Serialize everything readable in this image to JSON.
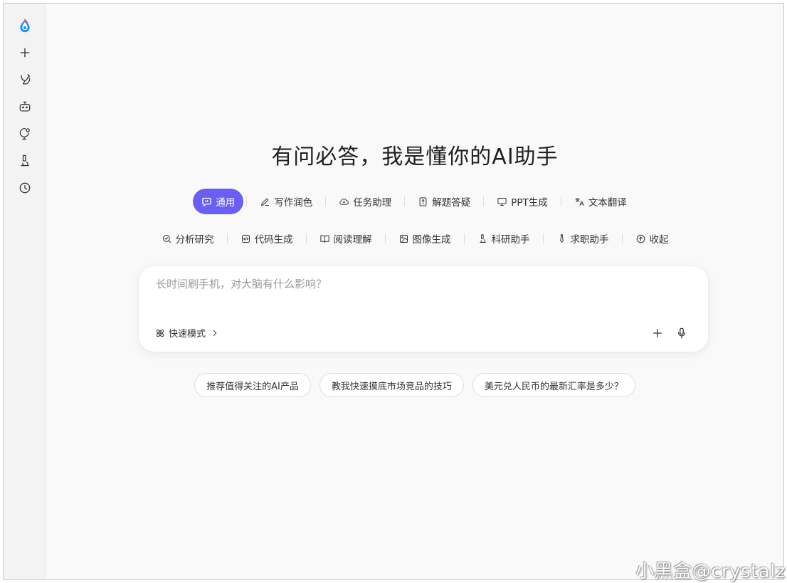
{
  "headline": "有问必答，我是懂你的AI助手",
  "tabs_row1": [
    {
      "label": "通用",
      "icon": "chat-bubble-icon",
      "active": true
    },
    {
      "label": "写作润色",
      "icon": "pen-icon"
    },
    {
      "label": "任务助理",
      "icon": "cloud-task-icon"
    },
    {
      "label": "解题答疑",
      "icon": "question-doc-icon"
    },
    {
      "label": "PPT生成",
      "icon": "presentation-icon"
    },
    {
      "label": "文本翻译",
      "icon": "translate-icon"
    }
  ],
  "tabs_row2": [
    {
      "label": "分析研究",
      "icon": "magnify-check-icon"
    },
    {
      "label": "代码生成",
      "icon": "code-icon"
    },
    {
      "label": "阅读理解",
      "icon": "book-icon"
    },
    {
      "label": "图像生成",
      "icon": "image-icon"
    },
    {
      "label": "科研助手",
      "icon": "microscope-icon"
    },
    {
      "label": "求职助手",
      "icon": "tie-icon"
    },
    {
      "label": "收起",
      "icon": "collapse-up-icon"
    }
  ],
  "input": {
    "placeholder": "长时间刷手机，对大脑有什么影响？",
    "mode_label": "快速模式"
  },
  "suggestions": [
    "推荐值得关注的AI产品",
    "教我快速摸底市场竞品的技巧",
    "美元兑人民币的最新汇率是多少？"
  ],
  "watermark": "小黑盒@crystalz",
  "colors": {
    "accent": "#6a5ff0",
    "logo_blue": "#1e90ff",
    "logo_red": "#ff4d4f"
  }
}
